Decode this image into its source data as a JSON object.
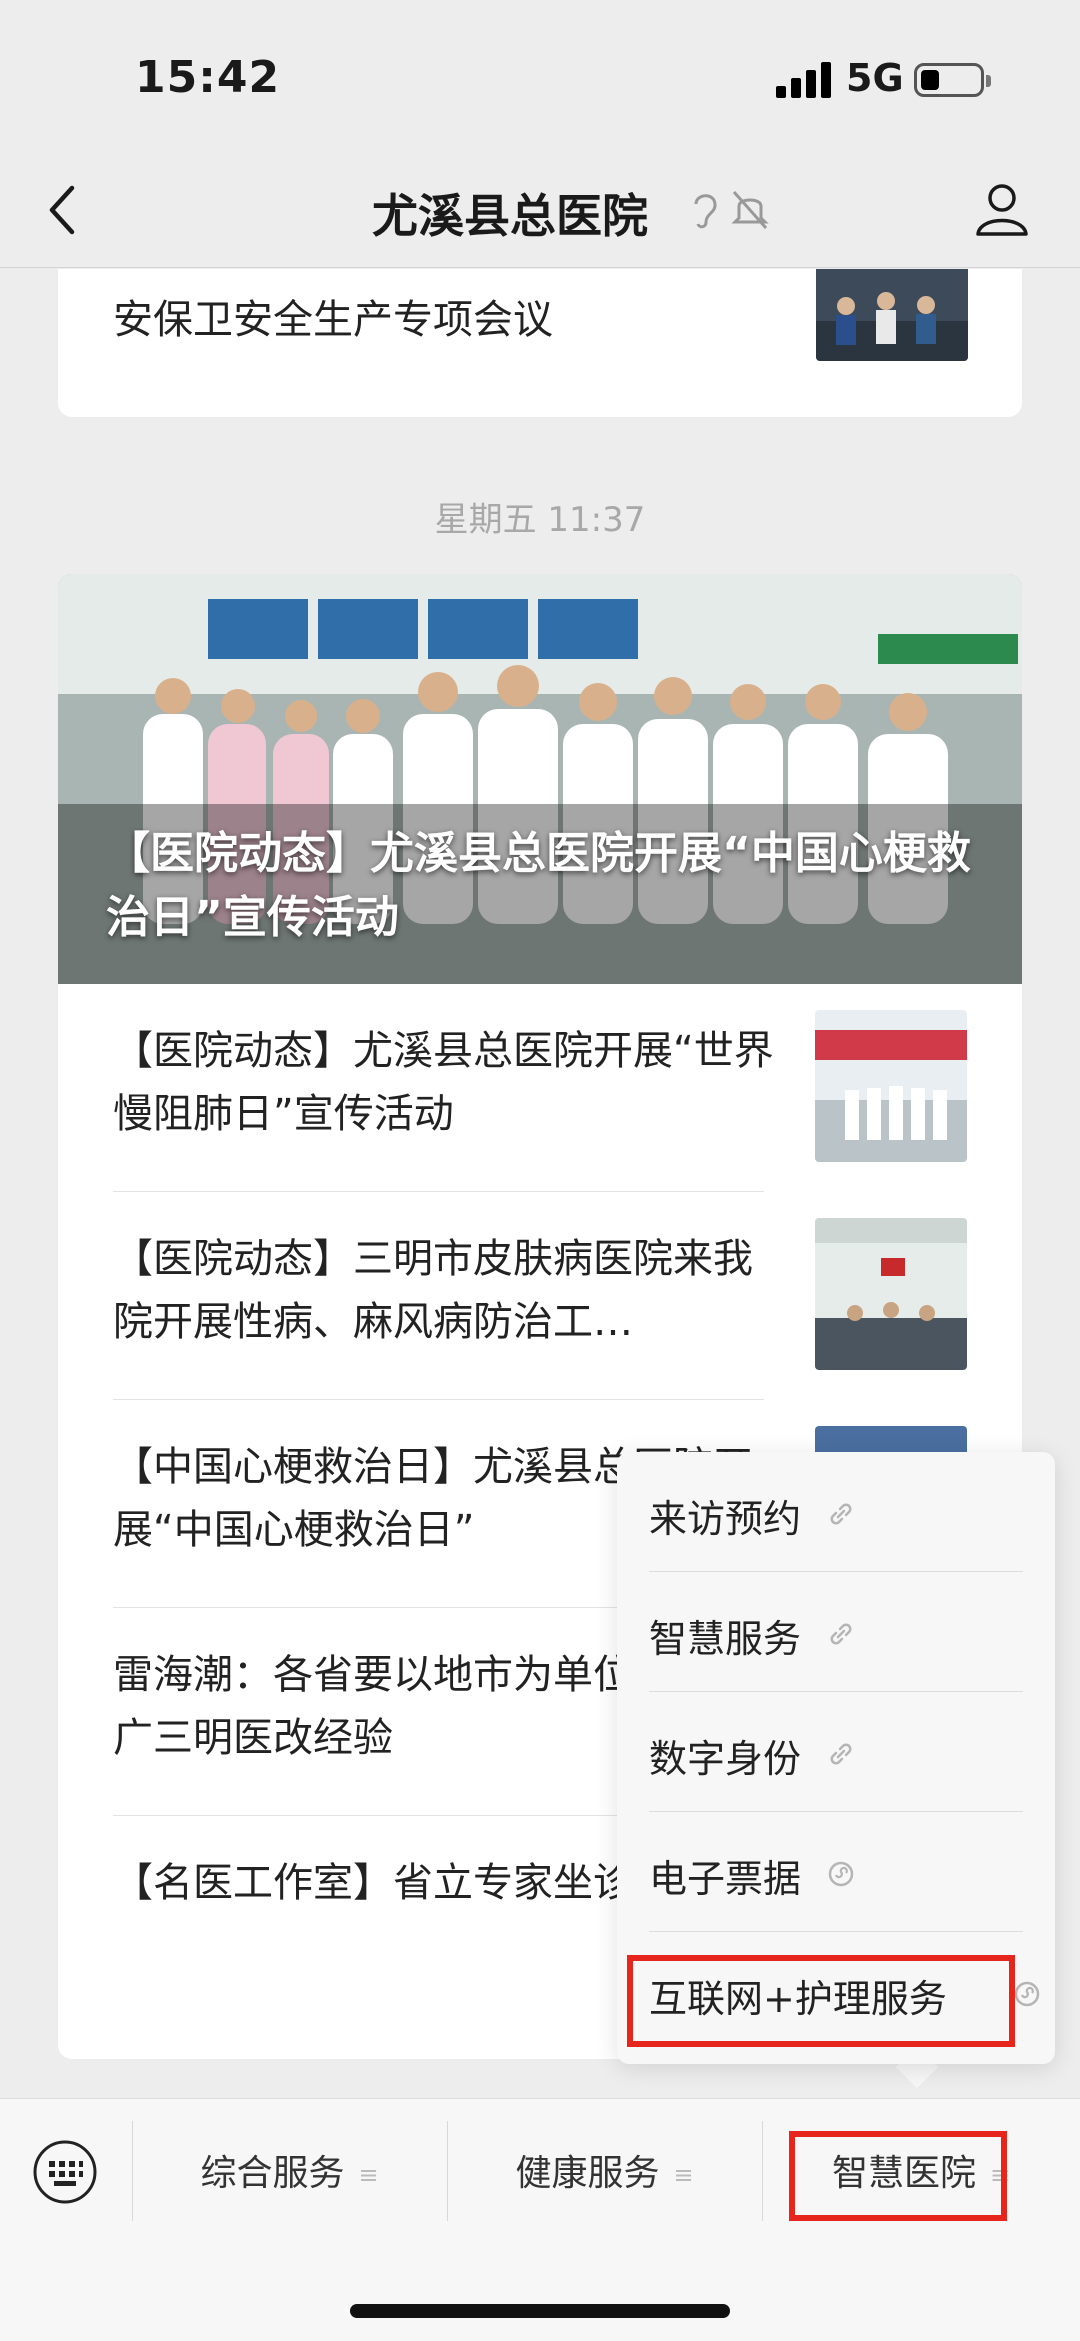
{
  "status_bar": {
    "time": "15:42",
    "network": "5G",
    "battery_level": 0.25
  },
  "nav": {
    "title": "尤溪县总医院"
  },
  "top_card": {
    "title": "安保卫安全生产专项会议"
  },
  "timestamp": "星期五 11:37",
  "hero": {
    "title": "【医院动态】尤溪县总医院开展“中国心梗救治日”宣传活动"
  },
  "articles": [
    {
      "title": "【医院动态】尤溪县总医院开展“世界慢阻肺日”宣传活动"
    },
    {
      "title": "【医院动态】三明市皮肤病医院来我院开展性病、麻风病防治工…"
    },
    {
      "title": "【中国心梗救治日】尤溪县总医院开展“中国心梗救治日”"
    },
    {
      "title": "雷海潮：各省要以地市为单位认真推广三明医改经验"
    },
    {
      "title": "【名医工作室】省立专家坐诊公布"
    }
  ],
  "popup_menu": {
    "items": [
      {
        "label": "来访预约"
      },
      {
        "label": "智慧服务"
      },
      {
        "label": "数字身份"
      },
      {
        "label": "电子票据"
      },
      {
        "label": "互联网+护理服务"
      }
    ]
  },
  "bottom_menu": {
    "tabs": [
      {
        "label": "综合服务"
      },
      {
        "label": "健康服务"
      },
      {
        "label": "智慧医院"
      }
    ]
  },
  "colors": {
    "highlight": "#e6251c",
    "background": "#ededed",
    "card": "#ffffff"
  },
  "icons": [
    "back-icon",
    "ear-icon",
    "bell-mute-icon",
    "profile-icon",
    "link-icon",
    "keyboard-icon",
    "menu-lines-icon"
  ]
}
